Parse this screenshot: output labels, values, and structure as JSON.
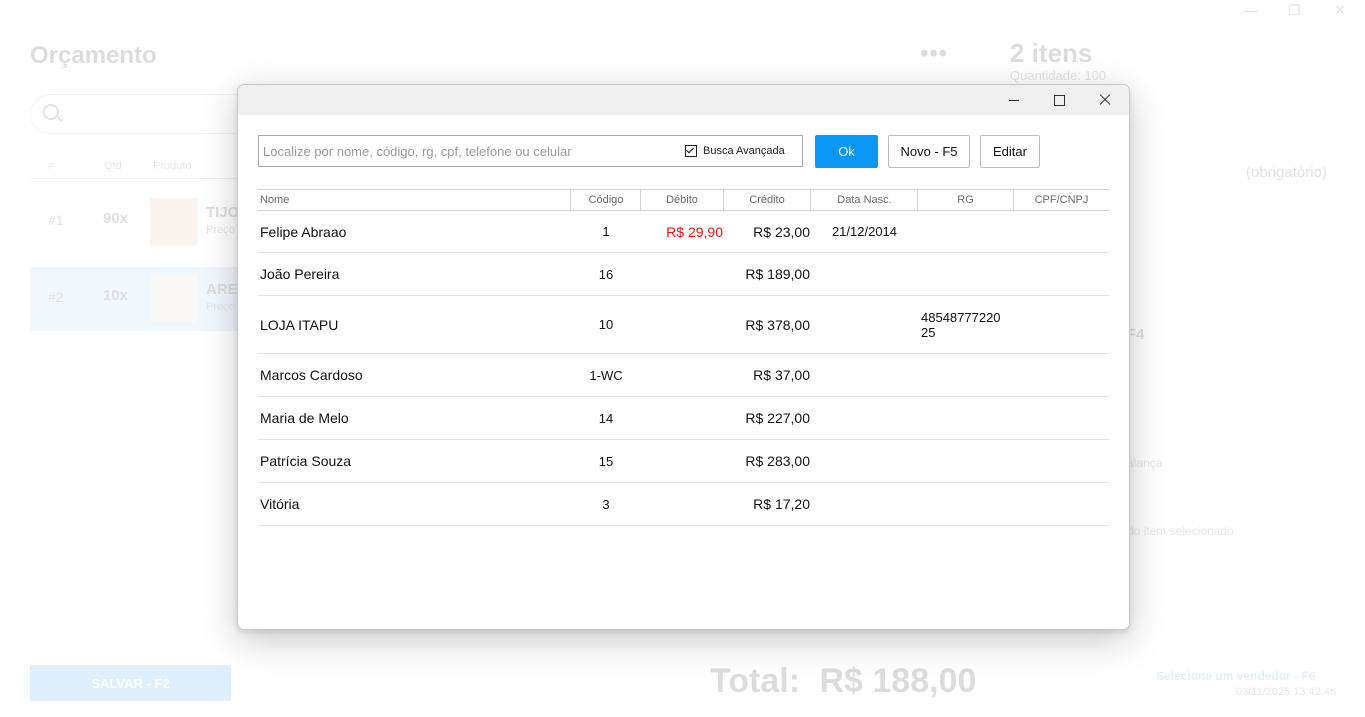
{
  "background": {
    "window_controls": [
      "—",
      "❐",
      "✕"
    ],
    "title": "Orçamento",
    "more_menu": "•••",
    "items_count": "2 itens",
    "quantity": "Quantidade: 100",
    "table_headers": [
      "#",
      "Qtd",
      "Produto"
    ],
    "rows": [
      {
        "index": "#1",
        "qty": "90x",
        "name": "TIJO",
        "price": "Preço"
      },
      {
        "index": "#2",
        "qty": "10x",
        "name": "ARE",
        "price": "Preço"
      }
    ],
    "customer_hint": "(obrigatório)",
    "f4_label": "F4",
    "balance_hint": "alança",
    "selected_item_hint": "do item selecionado",
    "save_button": "SALVAR - F2",
    "total_label": "Total:",
    "total_value": "R$ 188,00",
    "seller_hint": "Selecione um vendedor - F6",
    "datetime": "03/11/2025 13:42:46"
  },
  "dialog": {
    "search": {
      "placeholder": "Localize por nome, código, rg, cpf, telefone ou celular",
      "value": ""
    },
    "advanced_search_label": "Busca Avançada",
    "advanced_search_checked": true,
    "buttons": {
      "ok": "Ok",
      "new": "Novo - F5",
      "edit": "Editar"
    },
    "columns": [
      "Nome",
      "Código",
      "Débito",
      "Crédito",
      "Data Nasc.",
      "RG",
      "CPF/CNPJ"
    ],
    "rows": [
      {
        "name": "Felipe Abraao",
        "code": "1",
        "debit": "R$ 29,90",
        "credit": "R$ 23,00",
        "dob": "21/12/2014",
        "rg": "",
        "cpf": ""
      },
      {
        "name": "João Pereira",
        "code": "16",
        "debit": "",
        "credit": "R$ 189,00",
        "dob": "",
        "rg": "",
        "cpf": ""
      },
      {
        "name": "LOJA ITAPU",
        "code": "10",
        "debit": "",
        "credit": "R$ 378,00",
        "dob": "",
        "rg": "48548777220\n25",
        "cpf": ""
      },
      {
        "name": "Marcos Cardoso",
        "code": "1-WC",
        "debit": "",
        "credit": "R$ 37,00",
        "dob": "",
        "rg": "",
        "cpf": ""
      },
      {
        "name": "Maria de Melo",
        "code": "14",
        "debit": "",
        "credit": "R$ 227,00",
        "dob": "",
        "rg": "",
        "cpf": ""
      },
      {
        "name": "Patrícia Souza",
        "code": "15",
        "debit": "",
        "credit": "R$ 283,00",
        "dob": "",
        "rg": "",
        "cpf": ""
      },
      {
        "name": "Vitória",
        "code": "3",
        "debit": "",
        "credit": "R$ 17,20",
        "dob": "",
        "rg": "",
        "cpf": ""
      }
    ],
    "colors": {
      "accent": "#0a97f5",
      "debit": "#e01616"
    }
  }
}
